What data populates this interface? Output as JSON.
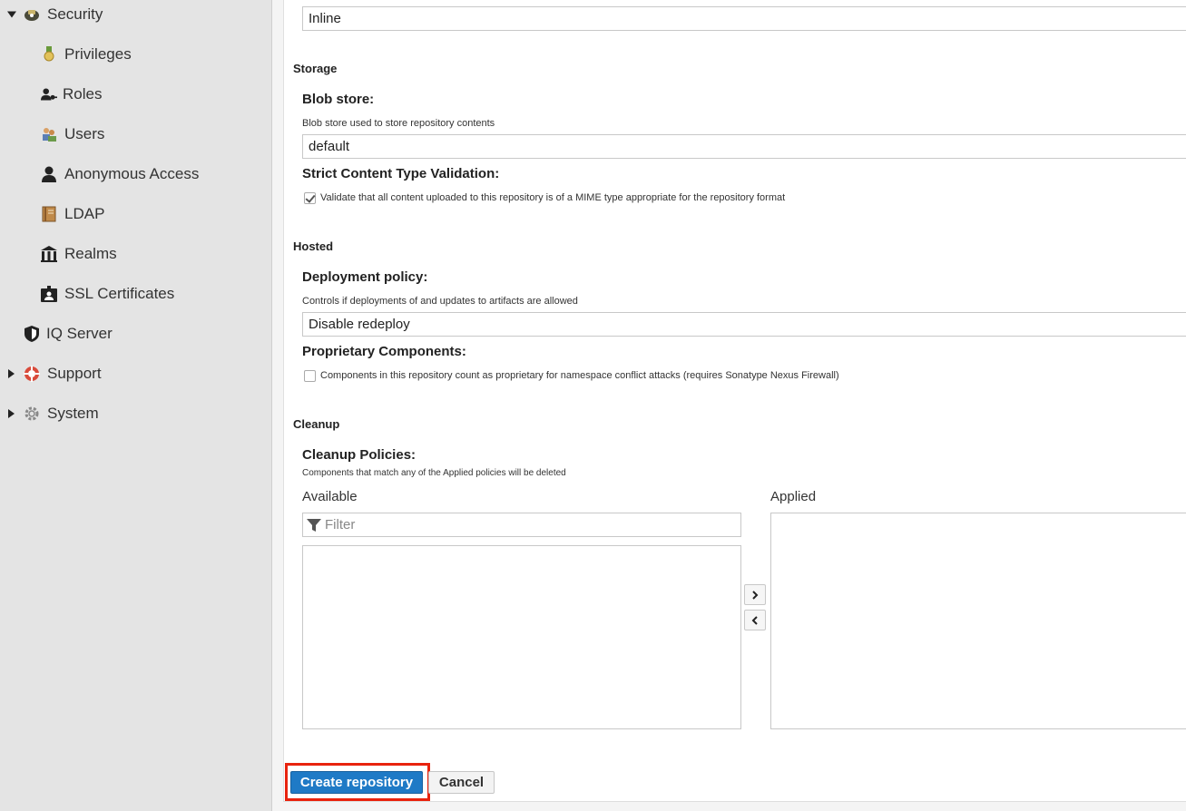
{
  "sidebar": {
    "items": [
      {
        "name": "security",
        "label": "Security",
        "icon": "security-icon",
        "expanded": true
      },
      {
        "name": "privileges",
        "label": "Privileges",
        "icon": "medal-icon"
      },
      {
        "name": "roles",
        "label": "Roles",
        "icon": "user-key-icon"
      },
      {
        "name": "users",
        "label": "Users",
        "icon": "users-icon"
      },
      {
        "name": "anonymous-access",
        "label": "Anonymous Access",
        "icon": "user-icon"
      },
      {
        "name": "ldap",
        "label": "LDAP",
        "icon": "book-icon"
      },
      {
        "name": "realms",
        "label": "Realms",
        "icon": "building-icon"
      },
      {
        "name": "ssl-certificates",
        "label": "SSL Certificates",
        "icon": "id-badge-icon"
      },
      {
        "name": "iq-server",
        "label": "IQ Server",
        "icon": "shield-icon"
      },
      {
        "name": "support",
        "label": "Support",
        "icon": "lifebuoy-icon",
        "expanded": false
      },
      {
        "name": "system",
        "label": "System",
        "icon": "gear-icon",
        "expanded": false
      }
    ]
  },
  "form": {
    "top_field_value": "Inline",
    "storage": {
      "section_title": "Storage",
      "blob_store_label": "Blob store:",
      "blob_store_help": "Blob store used to store repository contents",
      "blob_store_value": "default",
      "strict_label": "Strict Content Type Validation:",
      "strict_checkbox_text": "Validate that all content uploaded to this repository is of a MIME type appropriate for the repository format",
      "strict_checked": true
    },
    "hosted": {
      "section_title": "Hosted",
      "deployment_label": "Deployment policy:",
      "deployment_help": "Controls if deployments of and updates to artifacts are allowed",
      "deployment_value": "Disable redeploy",
      "proprietary_label": "Proprietary Components:",
      "proprietary_checkbox_text": "Components in this repository count as proprietary for namespace conflict attacks (requires Sonatype Nexus Firewall)",
      "proprietary_checked": false
    },
    "cleanup": {
      "section_title": "Cleanup",
      "policies_label": "Cleanup Policies:",
      "policies_help": "Components that match any of the Applied policies will be deleted",
      "available_title": "Available",
      "applied_title": "Applied",
      "filter_placeholder": "Filter"
    }
  },
  "buttons": {
    "create_label": "Create repository",
    "cancel_label": "Cancel",
    "highlight_color": "#e8230e",
    "primary_color": "#1f7ac6"
  }
}
